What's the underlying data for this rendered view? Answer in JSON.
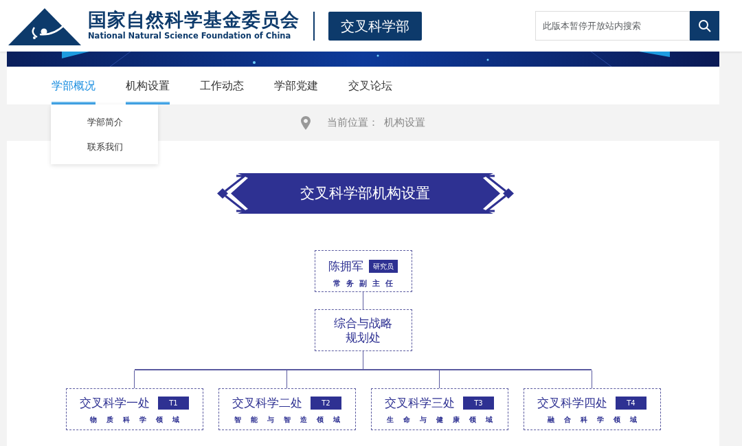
{
  "header": {
    "org_name": "国家自然科学基金委员会",
    "org_name_en": "National Natural Science Foundation of China",
    "department_button": "交叉科学部",
    "search": {
      "placeholder": "此版本暂停开放站内搜索"
    }
  },
  "nav": [
    {
      "label": "学部概况",
      "selected": true,
      "underlined": true
    },
    {
      "label": "机构设置",
      "selected": false,
      "underlined": true
    },
    {
      "label": "工作动态",
      "selected": false,
      "underlined": false
    },
    {
      "label": "学部党建",
      "selected": false,
      "underlined": false
    },
    {
      "label": "交叉论坛",
      "selected": false,
      "underlined": false
    }
  ],
  "dropdown": {
    "items": [
      "学部简介",
      "联系我们"
    ]
  },
  "breadcrumb": {
    "prefix": "当前位置：",
    "current": "机构设置"
  },
  "title": "交叉科学部机构设置",
  "org_chart": {
    "head": {
      "name": "陈拥军",
      "badge": "研究员",
      "role": "常务副主任"
    },
    "office": [
      "综合与战略",
      "规划处"
    ],
    "divisions": [
      {
        "name": "交叉科学一处",
        "badge": "T1",
        "field": "物质科学领域"
      },
      {
        "name": "交叉科学二处",
        "badge": "T2",
        "field": "智能与智造领域"
      },
      {
        "name": "交叉科学三处",
        "badge": "T3",
        "field": "生命与健康领域"
      },
      {
        "name": "交叉科学四处",
        "badge": "T4",
        "field": "融合科学领域"
      }
    ]
  }
}
